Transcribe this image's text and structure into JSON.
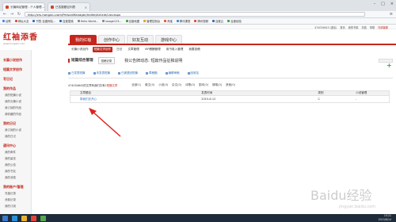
{
  "browser": {
    "tabs": [
      {
        "label": "长篇网站管理 - 个人管理..."
      },
      {
        "label": "已答疑题目列表"
      }
    ],
    "url": "http://zrs.hongxiu.com/PersonManager/Indite/Article/List.aspx",
    "bookmarks": [
      {
        "label": "谷歌",
        "color": "#4285f4"
      },
      {
        "label": "网址大全",
        "color": "#e0463a"
      },
      {
        "label": "书签-百度网站...",
        "color": "#2f6fb7"
      },
      {
        "label": "百度搜索",
        "color": "#2f6fb7"
      },
      {
        "label": "Hello World...",
        "color": "#888"
      },
      {
        "label": "baoge123...",
        "color": "#888"
      },
      {
        "label": "百度地图",
        "color": "#3aa53a"
      },
      {
        "label": "管理控制台",
        "color": "#e0a020"
      },
      {
        "label": "淘宝",
        "color": "#e05a20"
      },
      {
        "label": "腾讯课堂",
        "color": "#2f8fd7"
      },
      {
        "label": "腾讯视频",
        "color": "#e0463a"
      },
      {
        "label": "百度云",
        "color": "#2f6fb7"
      },
      {
        "label": "百度经验",
        "color": "#3aa53a"
      }
    ]
  },
  "site": {
    "top_info": {
      "user": "474034643 (退出)",
      "links": [
        "首页",
        "我的书架",
        "充值",
        "帮助"
      ],
      "link_highlight": "在线客服"
    },
    "logo": {
      "main": "红袖添香",
      "sub": "www.hongxiu.com"
    },
    "main_nav": [
      {
        "label": "我的红袖"
      },
      {
        "label": "创作中心"
      },
      {
        "label": "好友互动"
      },
      {
        "label": "游戏中心"
      }
    ],
    "sub_nav": [
      {
        "label": "长篇小说创作"
      },
      {
        "label": "短篇文学创作"
      },
      {
        "label": "日记"
      },
      {
        "label": "文章管理"
      },
      {
        "label": "VIP稿酬管理"
      },
      {
        "label": "用书收入管理"
      },
      {
        "label": "我要投稿"
      }
    ]
  },
  "sidebar": {
    "sections": [
      {
        "title": "长篇小说创作",
        "items": []
      },
      {
        "title": "短篇文学创作",
        "items": []
      },
      {
        "title": "写日记",
        "items": []
      },
      {
        "title": "我的作品",
        "items": [
          "我的短篇小说",
          "我的长篇小说",
          "我订阅的作品",
          "我收藏的作品"
        ]
      },
      {
        "title": "我的日记",
        "items": [
          "我订阅的小说",
          "我的日记"
        ]
      },
      {
        "title": "通讯中心",
        "items": [
          "我的邮件",
          "我的留言",
          "我的公告",
          "我的书友",
          "我的消息"
        ]
      },
      {
        "title": "我的账户/管理",
        "items": [
          "充值记录",
          "消费记录",
          "我的订阅"
        ]
      }
    ]
  },
  "content": {
    "section_title": "短篇综合管理",
    "section_button": "投稿记录",
    "banner": "我公告牌动态: 短篇作品征稿说明 ",
    "categories": [
      {
        "label": "已发表短篇"
      },
      {
        "label": "未发表短篇"
      },
      {
        "label": "已被退回短篇"
      },
      {
        "label": "草稿箱"
      },
      {
        "label": "编辑审稿"
      },
      {
        "label": "回收站"
      }
    ],
    "count_text": "474034643的文章有我们共有1",
    "count_highlight": "短篇文章",
    "filters": [
      "全部(1)",
      "散文(0)",
      "小说(0)",
      "杂文(0)",
      "诗歌(0)",
      "剧本(0)",
      "随笔(0)",
      "其他(0)"
    ],
    "table": {
      "headers": [
        "文章题目",
        "发表时间",
        "类别",
        "小说管理"
      ],
      "rows": [
        {
          "title": "带我们去开心",
          "date": "2015-6-12",
          "category": "C",
          "manage": "-"
        }
      ]
    }
  },
  "taskbar": {
    "time": "15:21",
    "date": "2015/6/14"
  },
  "watermark": {
    "text": "Baidu经验",
    "sub": "jingyan.baidu.com"
  },
  "colors": {
    "brand_red": "#c4261d",
    "link_blue": "#2f6fb7",
    "taskbar": "#1d2b3a"
  }
}
